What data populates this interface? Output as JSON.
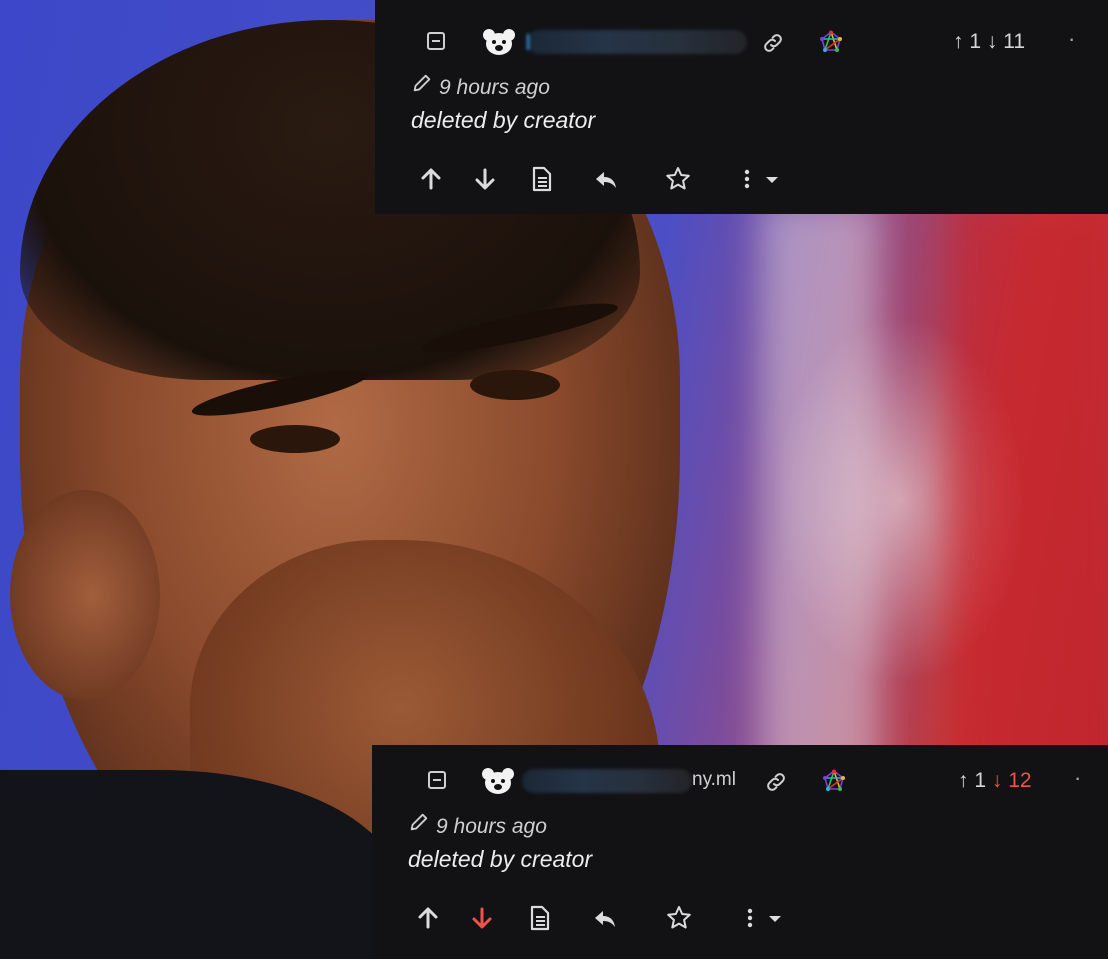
{
  "background_image": {
    "description_icon": "portrait-photo"
  },
  "comments": [
    {
      "collapse_icon": "collapse-minus-icon",
      "avatar_icon": "bear-avatar-icon",
      "username_suffix": "",
      "link_icon": "link-icon",
      "fediverse_icon": "fediverse-icon",
      "upvotes": "1",
      "downvotes": "11",
      "downvote_active": false,
      "more_dot": "·",
      "edited_icon": "pencil-icon",
      "timestamp": "9 hours ago",
      "body": "deleted by creator",
      "actions": [
        "upvote-icon",
        "downvote-icon",
        "view-source-icon",
        "reply-icon",
        "save-star-icon",
        "more-options-icon"
      ]
    },
    {
      "collapse_icon": "collapse-minus-icon",
      "avatar_icon": "bear-avatar-icon",
      "username_suffix": "ny.ml",
      "link_icon": "link-icon",
      "fediverse_icon": "fediverse-icon",
      "upvotes": "1",
      "downvotes": "12",
      "downvote_active": true,
      "more_dot": "·",
      "edited_icon": "pencil-icon",
      "timestamp": "9 hours ago",
      "body": "deleted by creator",
      "actions": [
        "upvote-icon",
        "downvote-icon",
        "view-source-icon",
        "reply-icon",
        "save-star-icon",
        "more-options-icon"
      ]
    }
  ],
  "colors": {
    "card_bg": "#121214",
    "downvote_active": "#f0524a",
    "text": "#dedede"
  }
}
